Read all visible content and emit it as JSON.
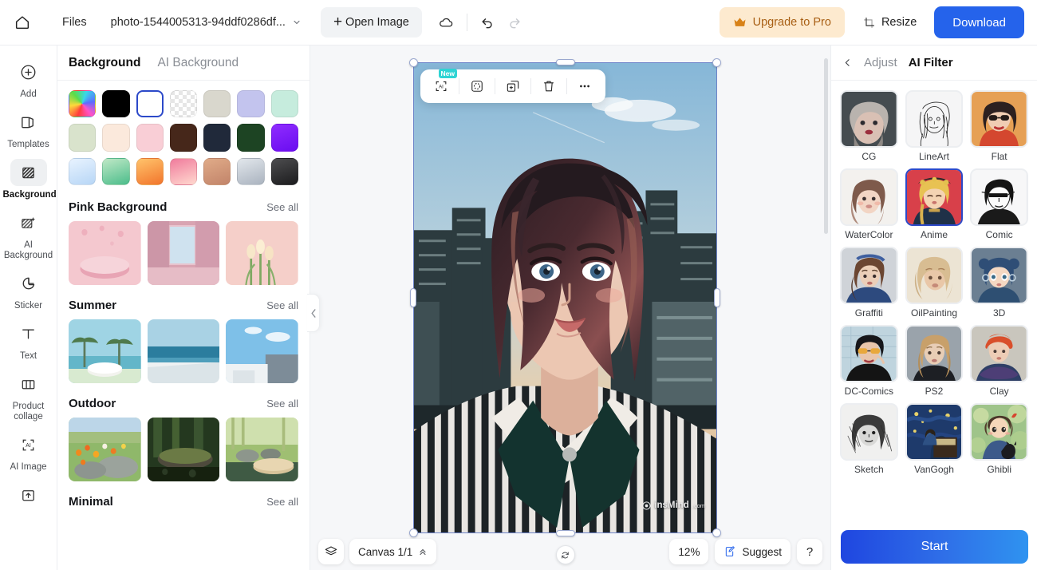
{
  "header": {
    "home_icon": "home-icon",
    "files_label": "Files",
    "filename": "photo-1544005313-94ddf0286df...",
    "open_image_label": "Open Image",
    "cloud_icon": "cloud-sync-icon",
    "undo_icon": "undo-icon",
    "redo_icon": "redo-icon",
    "upgrade_label": "Upgrade to Pro",
    "crown_icon": "crown-icon",
    "resize_label": "Resize",
    "resize_icon": "resize-icon",
    "download_label": "Download",
    "accent_blue": "#2563eb",
    "upgrade_bg": "#fdeacf",
    "upgrade_fg": "#a85f14"
  },
  "rail": {
    "items": [
      {
        "label": "Add",
        "icon": "plus-circle-icon",
        "active": false
      },
      {
        "label": "Templates",
        "icon": "templates-icon",
        "active": false
      },
      {
        "label": "Background",
        "icon": "background-hatch-icon",
        "active": true
      },
      {
        "label": "AI Background",
        "icon": "ai-background-icon",
        "active": false
      },
      {
        "label": "Sticker",
        "icon": "sticker-icon",
        "active": false
      },
      {
        "label": "Text",
        "icon": "text-t-icon",
        "active": false
      },
      {
        "label": "Product collage",
        "icon": "collage-icon",
        "active": false
      },
      {
        "label": "AI Image",
        "icon": "ai-image-icon",
        "active": false
      },
      {
        "label": "",
        "icon": "upload-folder-icon",
        "active": false
      }
    ]
  },
  "background_panel": {
    "tabs": [
      {
        "label": "Background",
        "active": true
      },
      {
        "label": "AI Background",
        "active": false
      }
    ],
    "swatches": [
      {
        "name": "rainbow-gradient",
        "color": "conic",
        "selected": false
      },
      {
        "name": "black",
        "color": "#000000",
        "selected": false
      },
      {
        "name": "white",
        "color": "#ffffff",
        "selected": true
      },
      {
        "name": "transparent",
        "color": "transparent",
        "selected": false
      },
      {
        "name": "warm-grey",
        "color": "#d9d7cd",
        "selected": false
      },
      {
        "name": "periwinkle",
        "color": "#c3c4ee",
        "selected": false
      },
      {
        "name": "mint",
        "color": "#c6ecdd",
        "selected": false
      },
      {
        "name": "sage",
        "color": "#d9e3cc",
        "selected": false
      },
      {
        "name": "cream",
        "color": "#fbe9dc",
        "selected": false
      },
      {
        "name": "pink",
        "color": "#f9ced6",
        "selected": false
      },
      {
        "name": "dark-brown",
        "color": "#46271a",
        "selected": false
      },
      {
        "name": "navy",
        "color": "#20293a",
        "selected": false
      },
      {
        "name": "forest-green",
        "color": "#1d4423",
        "selected": false
      },
      {
        "name": "violet",
        "color": "#7f1bf5",
        "selected": false
      },
      {
        "name": "sky-gradient",
        "color": "#cfe3f8",
        "selected": false
      },
      {
        "name": "green-gradient",
        "color": "#84d0a4",
        "selected": false
      },
      {
        "name": "orange-gradient",
        "color": "#f59548",
        "selected": false
      },
      {
        "name": "rose-gradient",
        "color": "#f08ba3",
        "selected": false
      },
      {
        "name": "tan-gradient",
        "color": "#d49878",
        "selected": false
      },
      {
        "name": "silver-gradient",
        "color": "#c2c9d2",
        "selected": false
      },
      {
        "name": "charcoal-gradient",
        "color": "#3a3a3c",
        "selected": false
      }
    ],
    "sections": [
      {
        "title": "Pink Background",
        "see_all": "See all",
        "thumbs": [
          "pink-podium",
          "pink-curtain-window",
          "pink-tulips"
        ]
      },
      {
        "title": "Summer",
        "see_all": "See all",
        "thumbs": [
          "palm-beach-podium",
          "ocean-horizon",
          "white-block-sky"
        ]
      },
      {
        "title": "Outdoor",
        "see_all": "See all",
        "thumbs": [
          "flower-meadow-rocks",
          "mossy-rock-forest",
          "zen-garden-podium"
        ]
      },
      {
        "title": "Minimal",
        "see_all": "See all",
        "thumbs": []
      }
    ],
    "collapse_icon": "chevron-left-icon"
  },
  "canvas": {
    "artwork_name": "anime-portrait-rooftop",
    "watermark": "insMind",
    "watermark_domain": ".com",
    "float_toolbar": [
      {
        "name": "ai-tool-button",
        "icon": "ai-bracket-icon",
        "badge": "New"
      },
      {
        "name": "retouch-button",
        "icon": "circle-dots-square-icon",
        "badge": ""
      },
      {
        "name": "duplicate-button",
        "icon": "duplicate-plus-icon",
        "badge": ""
      },
      {
        "name": "delete-button",
        "icon": "trash-icon",
        "badge": ""
      },
      {
        "name": "more-button",
        "icon": "ellipsis-icon",
        "badge": ""
      }
    ],
    "rotate_icon": "rotate-icon",
    "selection_color": "#6d84c9"
  },
  "bottom_bar": {
    "layers_icon": "layers-icon",
    "canvas_label": "Canvas 1/1",
    "canvas_chevron": "chevron-up-double-icon",
    "zoom_level": "12%",
    "suggest_label": "Suggest",
    "suggest_icon": "suggest-clipboard-icon",
    "help_label": "?"
  },
  "right_panel": {
    "back_icon": "chevron-left-icon",
    "tabs": [
      {
        "label": "Adjust",
        "active": false
      },
      {
        "label": "AI Filter",
        "active": true
      }
    ],
    "filters": [
      {
        "label": "CG",
        "thumb": "cg-portrait",
        "selected": false
      },
      {
        "label": "LineArt",
        "thumb": "lineart-portrait",
        "selected": false
      },
      {
        "label": "Flat",
        "thumb": "flat-portrait",
        "selected": false
      },
      {
        "label": "WaterColor",
        "thumb": "watercolor-portrait",
        "selected": false
      },
      {
        "label": "Anime",
        "thumb": "anime-portrait",
        "selected": true
      },
      {
        "label": "Comic",
        "thumb": "comic-portrait",
        "selected": false
      },
      {
        "label": "Graffiti",
        "thumb": "graffiti-portrait",
        "selected": false
      },
      {
        "label": "OilPainting",
        "thumb": "oilpainting-portrait",
        "selected": false
      },
      {
        "label": "3D",
        "thumb": "3d-portrait",
        "selected": false
      },
      {
        "label": "DC-Comics",
        "thumb": "dccomics-portrait",
        "selected": false
      },
      {
        "label": "PS2",
        "thumb": "ps2-portrait",
        "selected": false
      },
      {
        "label": "Clay",
        "thumb": "clay-portrait",
        "selected": false
      },
      {
        "label": "Sketch",
        "thumb": "sketch-portrait",
        "selected": false
      },
      {
        "label": "VanGogh",
        "thumb": "vangogh-portrait",
        "selected": false
      },
      {
        "label": "Ghibli",
        "thumb": "ghibli-portrait",
        "selected": false
      }
    ],
    "start_label": "Start"
  }
}
